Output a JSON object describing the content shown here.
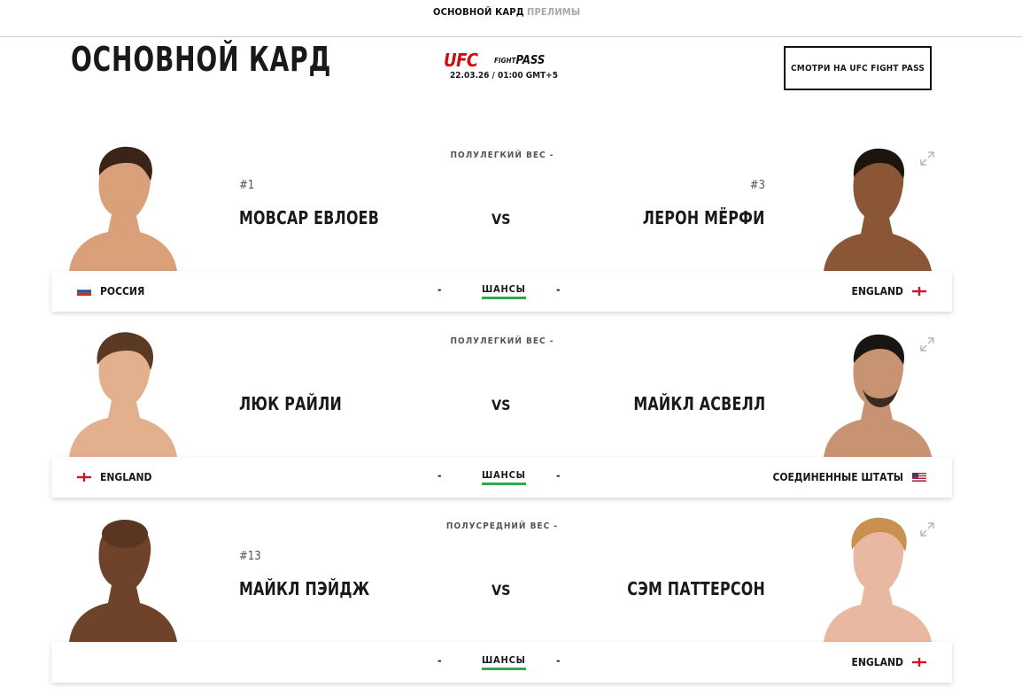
{
  "tabs": {
    "main_card": "ОСНОВНОЙ КАРД",
    "prelims": "ПРЕЛИМЫ"
  },
  "header": {
    "title": "ОСНОВНОЙ КАРД",
    "brand_ufc": "UFC",
    "brand_fight": "FIGHT",
    "brand_pass": "PASS",
    "event_date": "22.03.26 / 01:00 GMT+5",
    "watch_button": "СМОТРИ НА UFC FIGHT PASS"
  },
  "bouts": [
    {
      "weight_class": "ПОЛУЛЕГКИЙ ВЕС -",
      "vs": "VS",
      "odds_label": "ШАНСЫ",
      "red": {
        "rank": "#1",
        "name": "МОВСАР ЕВЛОЕВ",
        "country": "РОССИЯ",
        "flag": "russia",
        "odds": "-"
      },
      "blue": {
        "rank": "#3",
        "name": "ЛЕРОН МЁРФИ",
        "country": "ENGLAND",
        "flag": "england",
        "odds": "-"
      }
    },
    {
      "weight_class": "ПОЛУЛЕГКИЙ ВЕС -",
      "vs": "VS",
      "odds_label": "ШАНСЫ",
      "red": {
        "rank": "",
        "name": "ЛЮК РАЙЛИ",
        "country": "ENGLAND",
        "flag": "england",
        "odds": "-"
      },
      "blue": {
        "rank": "",
        "name": "МАЙКЛ АСВЕЛЛ",
        "country": "СОЕДИНЕННЫЕ ШТАТЫ",
        "flag": "usa",
        "odds": "-"
      }
    },
    {
      "weight_class": "ПОЛУСРЕДНИЙ ВЕС -",
      "vs": "VS",
      "odds_label": "ШАНСЫ",
      "red": {
        "rank": "#13",
        "name": "МАЙКЛ ПЭЙДЖ",
        "country": "",
        "flag": "",
        "odds": "-"
      },
      "blue": {
        "rank": "",
        "name": "СЭМ ПАТТЕРСОН",
        "country": "ENGLAND",
        "flag": "england",
        "odds": "-"
      }
    }
  ],
  "colors": {
    "accent_red": "#d20a0a",
    "odds_underline": "#2fa84f"
  },
  "icons": {
    "expand": "expand-arrows-icon"
  }
}
